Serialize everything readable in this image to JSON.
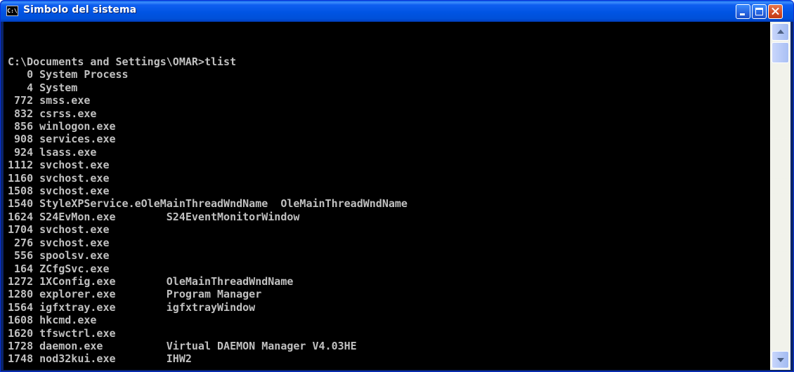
{
  "window": {
    "title": "Simbolo del sistema",
    "icon": "console-icon",
    "icon_text": "C:\\"
  },
  "controls": {
    "minimize_icon": "minimize-icon",
    "maximize_icon": "maximize-icon",
    "close_icon": "close-icon"
  },
  "console": {
    "prompt_line": "C:\\Documents and Settings\\OMAR>tlist",
    "lines": [
      "   0 System Process",
      "   4 System",
      " 772 smss.exe",
      " 832 csrss.exe",
      " 856 winlogon.exe",
      " 908 services.exe",
      " 924 lsass.exe",
      "1112 svchost.exe",
      "1160 svchost.exe",
      "1508 svchost.exe",
      "1540 StyleXPService.eOleMainThreadWndName  OleMainThreadWndName",
      "1624 S24EvMon.exe        S24EventMonitorWindow",
      "1704 svchost.exe",
      " 276 svchost.exe",
      " 556 spoolsv.exe",
      " 164 ZCfgSvc.exe",
      "1272 1XConfig.exe        OleMainThreadWndName",
      "1280 explorer.exe        Program Manager",
      "1564 igfxtray.exe        igfxtrayWindow",
      "1608 hkcmd.exe",
      "1620 tfswctrl.exe",
      "1728 daemon.exe          Virtual DAEMON Manager V4.03HE",
      "1748 nod32kui.exe        IHW2"
    ]
  },
  "scrollbar": {
    "position": 0.0
  },
  "colors": {
    "titlebar": "#0054e3",
    "console_bg": "#000000",
    "console_fg": "#c0c0c0",
    "close_button": "#d24a24"
  }
}
